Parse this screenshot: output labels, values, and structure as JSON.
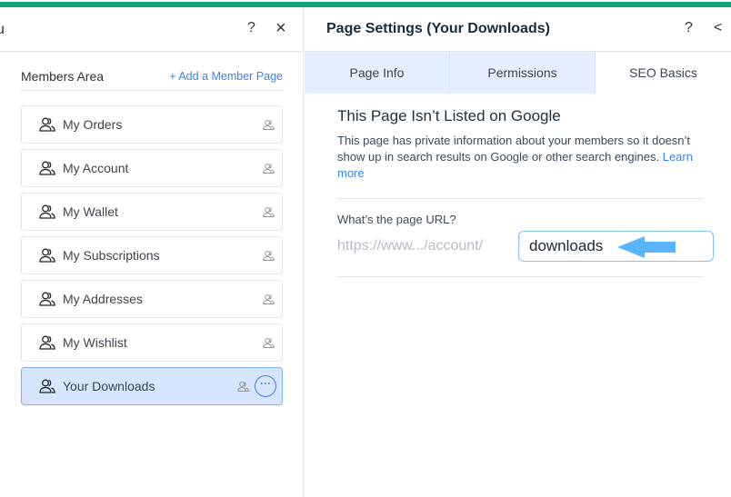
{
  "left_panel": {
    "clipped_title": "u",
    "help_label": "?",
    "close_label": "×",
    "section_title": "Members Area",
    "add_page": "+ Add a Member Page",
    "items": [
      {
        "label": "My Orders"
      },
      {
        "label": "My Account"
      },
      {
        "label": "My Wallet"
      },
      {
        "label": "My Subscriptions"
      },
      {
        "label": "My Addresses"
      },
      {
        "label": "My Wishlist"
      },
      {
        "label": "Your Downloads",
        "selected": true
      }
    ],
    "more_label": "···"
  },
  "right_panel": {
    "title": "Page Settings (Your Downloads)",
    "help_label": "?",
    "back_label": "<",
    "tabs": [
      {
        "label": "Page Info"
      },
      {
        "label": "Permissions"
      },
      {
        "label": "SEO Basics",
        "active": true
      }
    ],
    "seo": {
      "heading": "This Page Isn’t Listed on Google",
      "description": "This page has private information about your members so it doesn’t show up in search results on Google or other search engines.",
      "learn_more": "Learn more",
      "url_label": "What’s the page URL?",
      "url_prefix": "https://www.../account/",
      "url_slug": "downloads"
    }
  },
  "colors": {
    "accent": "#3b82f6",
    "top_bar": "#0ea578",
    "arrow": "#5ab4fa",
    "selected_bg": "#d6e6fe"
  }
}
